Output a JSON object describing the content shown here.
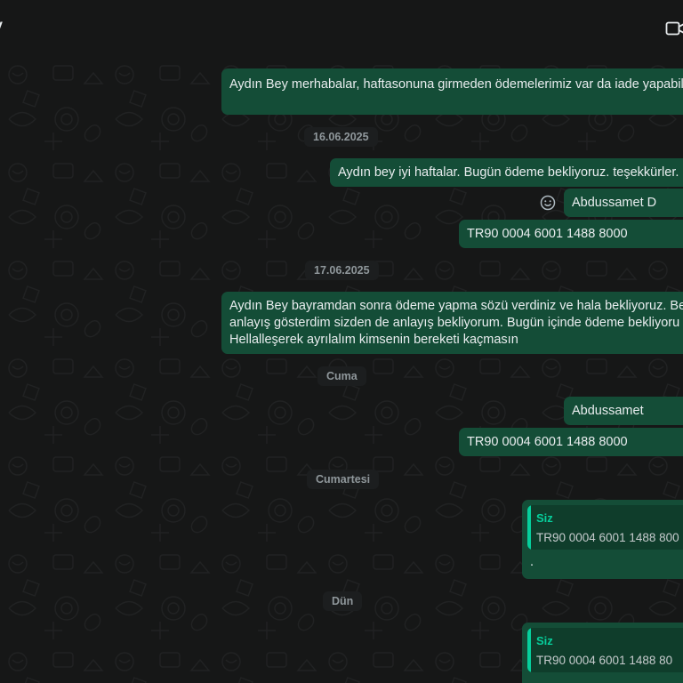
{
  "header": {
    "contact_name_fragment": "y",
    "video_call_icon": "video-camera-icon"
  },
  "dates": {
    "d1": "16.06.2025",
    "d2": "17.06.2025",
    "d3": "Cuma",
    "d4": "Cumartesi",
    "d5": "Dün"
  },
  "messages": {
    "m1": "Aydın Bey merhabalar, haftasonuna girmeden ödemelerimiz var da iade yapabil",
    "m2": "Aydın bey iyi haftalar. Bugün ödeme bekliyoruz. teşekkürler.",
    "m3": "Abdussamet D",
    "m4": "TR90 0004 6001 1488 8000",
    "m5_line1": "Aydın Bey bayramdan sonra ödeme yapma sözü verdiniz ve hala bekliyoruz. Be",
    "m5_line2": "anlayış gösterdim sizden de anlayış bekliyorum. Bugün içinde ödeme bekliyoru",
    "m5_line3": "Hellalleşerek ayrılalım kimsenin bereketi kaçmasın",
    "m6": "Abdussamet",
    "m7": "TR90 0004 6001 1488 8000",
    "m8": {
      "quote_author": "Siz",
      "quote_text": "TR90 0004 6001 1488 800",
      "body": "."
    },
    "m9": {
      "quote_author": "Siz",
      "quote_text": "TR90 0004 6001 1488 80"
    }
  },
  "icons": {
    "emoji": "smiley-icon",
    "video": "video-camera-icon"
  },
  "colors": {
    "background": "#161717",
    "outgoing_bubble": "#144d37",
    "quote_accent": "#06cf9c",
    "text": "#e9edef"
  }
}
